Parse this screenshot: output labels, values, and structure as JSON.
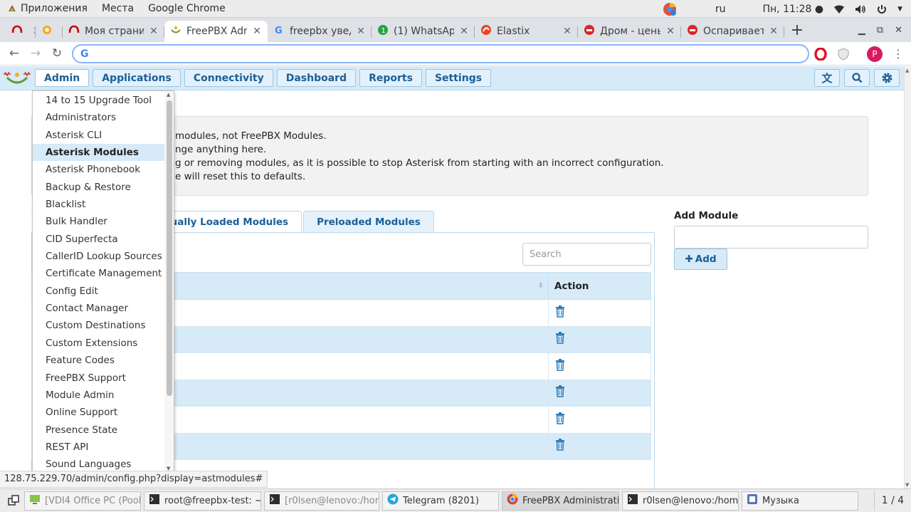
{
  "topbar": {
    "apps_label": "Приложения",
    "places_label": "Места",
    "app_name": "Google Chrome",
    "lang": "ru",
    "clock": "Пн, 11:28 ●"
  },
  "tabs": [
    {
      "title": "",
      "icon": "redhat-icon",
      "width": 42
    },
    {
      "title": "",
      "icon": "sun-icon",
      "width": 38
    },
    {
      "title": "Моя страница",
      "icon": "redhat-icon",
      "width": 143
    },
    {
      "title": "FreePBX Admi",
      "icon": "freepbx-icon",
      "width": 145,
      "active": true
    },
    {
      "title": "freepbx уведо",
      "icon": "google-icon",
      "width": 146
    },
    {
      "title": "(1) WhatsApp",
      "icon": "whatsapp-icon",
      "width": 145
    },
    {
      "title": "Elastix",
      "icon": "elastix-icon",
      "width": 145
    },
    {
      "title": "Дром - цены",
      "icon": "drom-icon",
      "width": 145
    },
    {
      "title": "Оспаривается",
      "icon": "drom-icon",
      "width": 145
    }
  ],
  "omnibox": {
    "value": ""
  },
  "nav": {
    "menus": [
      "Admin",
      "Applications",
      "Connectivity",
      "Dashboard",
      "Reports",
      "Settings"
    ],
    "open_menu": "Admin"
  },
  "dropdown": {
    "items": [
      "14 to 15 Upgrade Tool",
      "Administrators",
      "Asterisk CLI",
      "Asterisk Modules",
      "Asterisk Phonebook",
      "Backup & Restore",
      "Blacklist",
      "Bulk Handler",
      "CID Superfecta",
      "CallerID Lookup Sources",
      "Certificate Management",
      "Config Edit",
      "Contact Manager",
      "Custom Destinations",
      "Custom Extensions",
      "Feature Codes",
      "FreePBX Support",
      "Module Admin",
      "Online Support",
      "Presence State",
      "REST API",
      "Sound Languages"
    ],
    "active_index": 3
  },
  "alert": {
    "lines": [
      "modules, not FreePBX Modules.",
      "nge anything here.",
      "g or removing modules, as it is possible to stop Asterisk from starting with an incorrect configuration.",
      "e will reset this to defaults."
    ]
  },
  "page_tabs": {
    "manual": "nually Loaded Modules",
    "preloaded": "Preloaded Modules"
  },
  "search": {
    "placeholder": "Search"
  },
  "table": {
    "action_header": "Action",
    "rows": 6
  },
  "add_module": {
    "label": "Add Module",
    "button": "Add"
  },
  "status_url": "128.75.229.70/admin/config.php?display=astmodules#",
  "taskbar": {
    "items": [
      {
        "label": "[VDI4 Office PC (Pool...",
        "dim": true,
        "width": 164
      },
      {
        "label": "root@freepbx-test: ~",
        "dim": false,
        "width": 165
      },
      {
        "label": "[r0lsen@lenovo:/hom...",
        "dim": true,
        "width": 162
      },
      {
        "label": "Telegram (8201)",
        "dim": false,
        "width": 164
      },
      {
        "label": "FreePBX Administrati...",
        "dim": false,
        "width": 165,
        "active": true
      },
      {
        "label": "r0lsen@lenovo:/hom...",
        "dim": false,
        "width": 164
      },
      {
        "label": "Музыка",
        "dim": false,
        "width": 164
      }
    ],
    "pager": "1 / 4"
  }
}
